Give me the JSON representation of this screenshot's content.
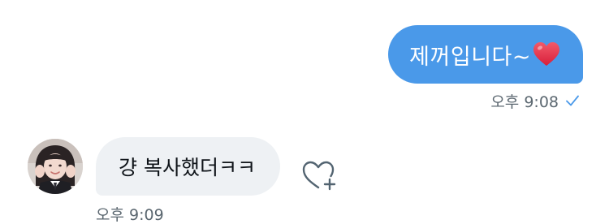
{
  "conversation": {
    "outgoing": {
      "text": "제꺼입니다~",
      "emoji": "heart-emoji",
      "time": "오후 9:08",
      "status_icon": "sent-check-icon",
      "bubble_color": "#4a99e9"
    },
    "incoming": {
      "text": "걍 복사했더ㅋㅋ",
      "time": "오후 9:09",
      "bubble_color": "#eef1f4",
      "like_icon": "add-reaction-heart-icon"
    }
  },
  "colors": {
    "accent": "#4a99e9",
    "meta_text": "#5b6770",
    "heart": "#e0245e"
  }
}
